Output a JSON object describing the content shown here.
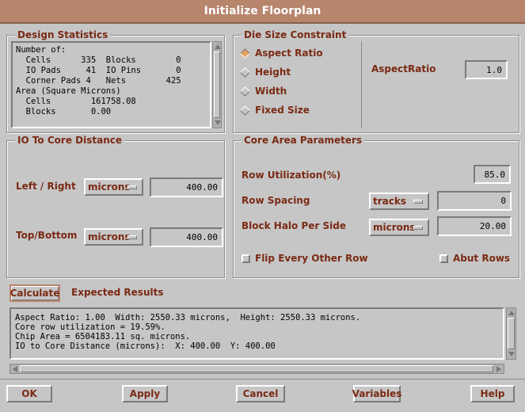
{
  "window": {
    "title": "Initialize Floorplan"
  },
  "design_statistics": {
    "title": "Design Statistics",
    "lines": [
      "Number of:",
      "  Cells      335  Blocks        0",
      "  IO Pads     41  IO Pins       0",
      "  Corner Pads 4   Nets        425",
      "Area (Square Microns)",
      "  Cells        161758.08",
      "  Blocks       0.00"
    ]
  },
  "die_size": {
    "title": "Die Size Constraint",
    "options": [
      "Aspect Ratio",
      "Height",
      "Width",
      "Fixed Size"
    ],
    "selected": "Aspect Ratio",
    "aspect_label": "AspectRatio",
    "aspect_value": "1.0"
  },
  "io_core": {
    "title": "IO To Core Distance",
    "left_right_label": "Left / Right",
    "left_right_unit": "microns",
    "left_right_value": "400.00",
    "top_bottom_label": "Top/Bottom",
    "top_bottom_unit": "microns",
    "top_bottom_value": "400.00"
  },
  "core_area": {
    "title": "Core Area Parameters",
    "row_util_label": "Row Utilization(%)",
    "row_util_value": "85.0",
    "row_spacing_label": "Row Spacing",
    "row_spacing_unit": "tracks",
    "row_spacing_value": "0",
    "halo_label": "Block Halo Per Side",
    "halo_unit": "microns",
    "halo_value": "20.00",
    "flip_label": "Flip Every Other Row",
    "abut_label": "Abut Rows"
  },
  "calculate": {
    "button": "Calculate",
    "results_label": "Expected Results",
    "lines": [
      "Aspect Ratio: 1.00  Width: 2550.33 microns,  Height: 2550.33 microns.",
      "Core row utilization = 19.59%.",
      "Chip Area = 6504183.11 sq. microns.",
      "IO to Core Distance (microns):  X: 400.00  Y: 400.00"
    ]
  },
  "buttons": {
    "ok": "OK",
    "apply": "Apply",
    "cancel": "Cancel",
    "variables": "Variables",
    "help": "Help"
  },
  "colors": {
    "titlebar": "#b7846c",
    "label": "#7a2a14",
    "background": "#c6c6c6",
    "selected_radio": "#e6a060"
  }
}
